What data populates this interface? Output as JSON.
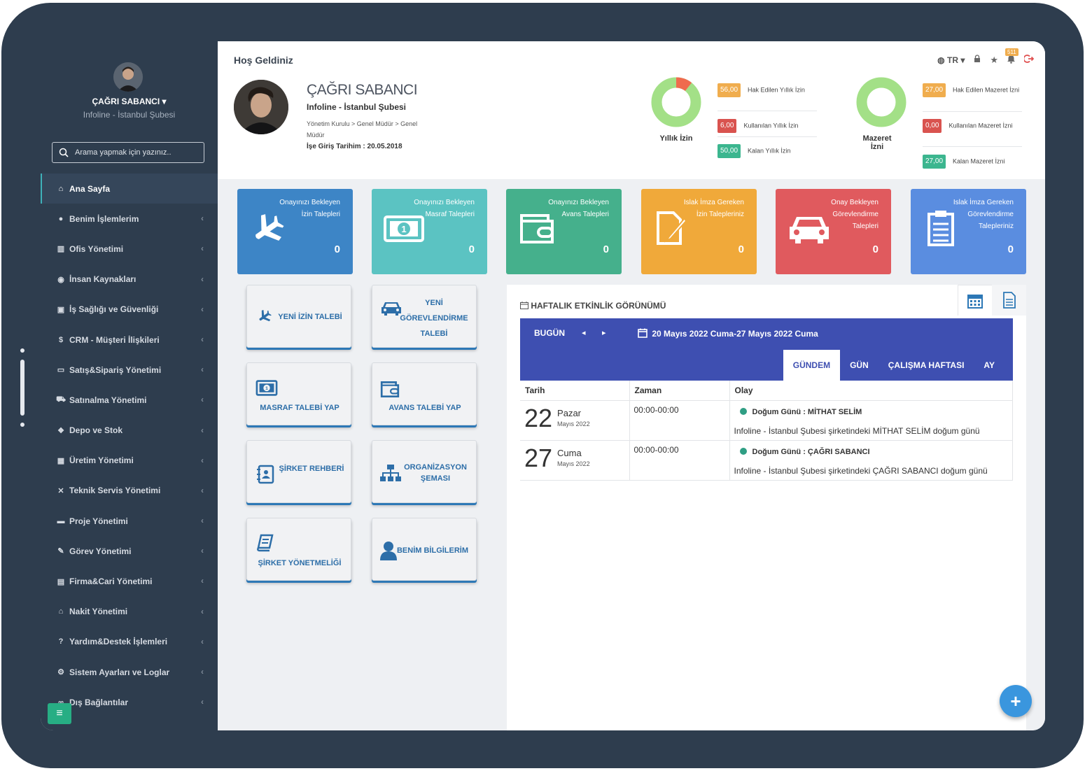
{
  "user": {
    "name": "ÇAĞRI SABANCI",
    "org": "Infoline - İstanbul Şubesi"
  },
  "search": {
    "placeholder": "Arama yapmak için yazınız.."
  },
  "nav": [
    {
      "label": "Ana Sayfa",
      "icon": "home-icon",
      "glyph": "⌂"
    },
    {
      "label": "Benim İşlemlerim",
      "icon": "user-icon",
      "glyph": "●"
    },
    {
      "label": "Ofis Yönetimi",
      "icon": "building-icon",
      "glyph": "▥"
    },
    {
      "label": "İnsan Kaynakları",
      "icon": "users-icon",
      "glyph": "◉"
    },
    {
      "label": "İş Sağlığı ve Güvenliği",
      "icon": "medkit-icon",
      "glyph": "▣"
    },
    {
      "label": "CRM - Müşteri İlişkileri",
      "icon": "dollar-icon",
      "glyph": "$"
    },
    {
      "label": "Satış&Sipariş Yönetimi",
      "icon": "money-icon",
      "glyph": "▭"
    },
    {
      "label": "Satınalma Yönetimi",
      "icon": "cart-icon",
      "glyph": "⛟"
    },
    {
      "label": "Depo ve Stok",
      "icon": "cubes-icon",
      "glyph": "❖"
    },
    {
      "label": "Üretim Yönetimi",
      "icon": "barcode-icon",
      "glyph": "▦"
    },
    {
      "label": "Teknik Servis Yönetimi",
      "icon": "tools-icon",
      "glyph": "✕"
    },
    {
      "label": "Proje Yönetimi",
      "icon": "briefcase-icon",
      "glyph": "▬"
    },
    {
      "label": "Görev Yönetimi",
      "icon": "wrench-icon",
      "glyph": "✎"
    },
    {
      "label": "Firma&Cari Yönetimi",
      "icon": "file-icon",
      "glyph": "▤"
    },
    {
      "label": "Nakit Yönetimi",
      "icon": "bank-icon",
      "glyph": "⌂"
    },
    {
      "label": "Yardım&Destek İşlemleri",
      "icon": "question-icon",
      "glyph": "?"
    },
    {
      "label": "Sistem Ayarları ve Loglar",
      "icon": "cogs-icon",
      "glyph": "⚙"
    },
    {
      "label": "Dış Bağlantılar",
      "icon": "link-icon",
      "glyph": "∞"
    }
  ],
  "header": {
    "title": "Hoş Geldiniz",
    "lang": "TR",
    "notifications": "511"
  },
  "profile": {
    "name": "ÇAĞRI SABANCI",
    "org": "Infoline - İstanbul Şubesi",
    "path": "Yönetim Kurulu > Genel Müdür > Genel Müdür",
    "start_date": "İşe Giriş Tarihim : 20.05.2018"
  },
  "annual_leave": {
    "label": "Yıllık İzin",
    "earned_value": "56,00",
    "earned_label": "Hak Edilen Yıllık İzin",
    "used_value": "6,00",
    "used_label": "Kullanılan Yıllık İzin",
    "remaining_value": "50,00",
    "remaining_label": "Kalan Yıllık İzin",
    "used_fraction": 0.107
  },
  "excuse_leave": {
    "label": "Mazeret İzni",
    "earned_value": "27,00",
    "earned_label": "Hak Edilen Mazeret İzni",
    "used_value": "0,00",
    "used_label": "Kullanılan Mazeret İzni",
    "remaining_value": "27,00",
    "remaining_label": "Kalan Mazeret İzni",
    "used_fraction": 0
  },
  "stats": [
    {
      "text": "Onayınızı Bekleyen İzin Talepleri",
      "value": "0",
      "color": "#3d85c6",
      "icon": "plane-icon"
    },
    {
      "text": "Onayınızı Bekleyen Masraf Talepleri",
      "value": "0",
      "color": "#5bc3c2",
      "icon": "money-bill-icon"
    },
    {
      "text": "Onayınızı Bekleyen Avans Talepleri",
      "value": "0",
      "color": "#45b08c",
      "icon": "wallet-icon"
    },
    {
      "text": "Islak İmza Gereken İzin Talepleriniz",
      "value": "0",
      "color": "#f0a93a",
      "icon": "signature-icon"
    },
    {
      "text": "Onay Bekleyen Görevlendirme Talepleri",
      "value": "0",
      "color": "#e05a5e",
      "icon": "car-icon"
    },
    {
      "text": "Islak İmza Gereken Görevlendirme Talepleriniz",
      "value": "0",
      "color": "#5a8de0",
      "icon": "clipboard-icon"
    }
  ],
  "quick": {
    "new_leave": "YENİ İZİN TALEBİ",
    "new_assignment": "YENİ GÖREVLENDİRME TALEBİ",
    "expense": "MASRAF TALEBİ YAP",
    "advance": "AVANS TALEBİ YAP",
    "directory": "ŞİRKET REHBERİ",
    "org_chart": "ORGANİZASYON ŞEMASI",
    "regulation": "ŞİRKET YÖNETMELİĞİ",
    "my_info": "BENİM BİLGİLERİM"
  },
  "calendar": {
    "title": "HAFTALIK ETKİNLİK GÖRÜNÜMÜ",
    "today": "BUGÜN",
    "range": "20 Mayıs 2022 Cuma-27 Mayıs 2022 Cuma",
    "views": [
      "GÜNDEM",
      "GÜN",
      "ÇALIŞMA HAFTASI",
      "AY"
    ],
    "columns": [
      "Tarih",
      "Zaman",
      "Olay"
    ],
    "events": [
      {
        "day": "22",
        "dayname": "Pazar",
        "month": "Mayıs 2022",
        "time": "00:00-00:00",
        "title": "Doğum Günü : MİTHAT SELİM",
        "desc": "Infoline - İstanbul Şubesi şirketindeki MİTHAT SELİM doğum günü"
      },
      {
        "day": "27",
        "dayname": "Cuma",
        "month": "Mayıs 2022",
        "time": "00:00-00:00",
        "title": "Doğum Günü : ÇAĞRI SABANCI",
        "desc": "Infoline - İstanbul Şubesi şirketindeki ÇAĞRI SABANCI doğum günü"
      }
    ]
  }
}
